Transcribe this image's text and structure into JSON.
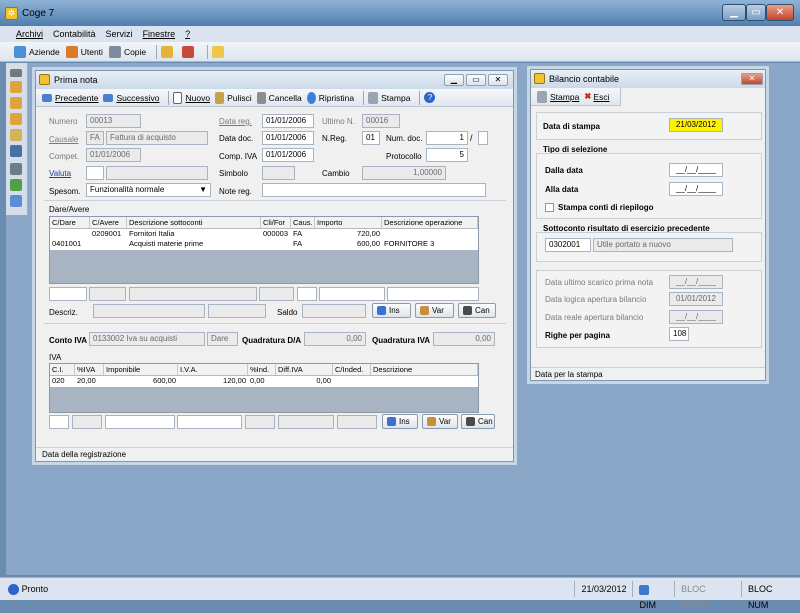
{
  "app": {
    "title": "Coge 7",
    "window_controls": {
      "minimize": "▁",
      "maximize": "▭",
      "close": "✕"
    }
  },
  "menu": [
    "Archivi",
    "Contabilità",
    "Servizi",
    "Finestre",
    "?"
  ],
  "toolbar": {
    "aziende": "Aziende",
    "utenti": "Utenti",
    "copie": "Copie"
  },
  "prima_nota": {
    "title": "Prima nota",
    "toolbar": {
      "precedente": "Precedente",
      "successivo": "Successivo",
      "nuovo": "Nuovo",
      "pulisci": "Pulisci",
      "cancella": "Cancella",
      "ripristina": "Ripristina",
      "stampa": "Stampa"
    },
    "labels": {
      "numero": "Numero",
      "causale": "Causale",
      "compet": "Compet.",
      "valuta": "Valuta",
      "spesom": "Spesom.",
      "data_reg": "Data reg.",
      "ultimo_n": "Ultimo N.",
      "data_doc": "Data doc.",
      "n_reg": "N.Reg.",
      "num_doc": "Num. doc.",
      "comp_iva": "Comp. IVA",
      "protocollo": "Protocollo",
      "simbolo": "Simbolo",
      "cambio": "Cambio",
      "note_reg": "Note reg."
    },
    "values": {
      "numero": "00013",
      "causale_code": "FA",
      "causale_desc": "Fattura di acquisto",
      "compet": "01/01/2006",
      "valuta": "",
      "spesom": "Funzionalità normale",
      "data_reg": "01/01/2006",
      "ultimo_n": "00016",
      "data_doc": "01/01/2006",
      "n_reg": "01",
      "num_doc": "1",
      "num_doc_sep": "/",
      "comp_iva": "01/01/2006",
      "protocollo": "5",
      "simbolo": "",
      "cambio": "1,00000",
      "note_reg": ""
    },
    "dare_avere": {
      "section": "Dare/Avere",
      "columns": [
        "C/Dare",
        "C/Avere",
        "Descrizione sottoconti",
        "Cli/For",
        "Caus.",
        "Importo",
        "Descrizione operazione"
      ],
      "rows": [
        [
          "",
          "0209001",
          "Fornitori Italia",
          "000003",
          "FA",
          "720,00",
          ""
        ],
        [
          "0401001",
          "",
          "Acquisti materie prime",
          "",
          "FA",
          "600,00",
          "FORNITORE 3"
        ]
      ],
      "descriz_label": "Descriz.",
      "saldo_label": "Saldo",
      "btn_ins": "Ins",
      "btn_var": "Var",
      "btn_can": "Can"
    },
    "conto_iva": {
      "label": "Conto IVA",
      "value": "0133002 Iva su acquisti",
      "dare": "Dare",
      "quadratura_da_label": "Quadratura D/A",
      "quadratura_da": "0,00",
      "quadratura_iva_label": "Quadratura IVA",
      "quadratura_iva": "0,00"
    },
    "iva": {
      "section": "IVA",
      "columns": [
        "C.I.",
        "%IVA",
        "Imponibile",
        "I.V.A.",
        "%Ind.",
        "Diff.IVA",
        "C/Inded.",
        "Descrizione"
      ],
      "rows": [
        [
          "020",
          "20,00",
          "600,00",
          "120,00",
          "0,00",
          "0,00",
          "",
          ""
        ]
      ],
      "btn_ins": "Ins",
      "btn_var": "Var",
      "btn_can": "Can"
    },
    "status": "Data della registrazione"
  },
  "bilancio": {
    "title": "Bilancio contabile",
    "toolbar": {
      "stampa": "Stampa",
      "esci": "Esci"
    },
    "data_stampa_label": "Data di stampa",
    "data_stampa": "21/03/2012",
    "tipo_selezione": "Tipo di selezione",
    "dalla_data_label": "Dalla data",
    "dalla_data": "__/__/____",
    "alla_data_label": "Alla data",
    "alla_data": "__/__/____",
    "stampa_riepilogo": "Stampa conti di riepilogo",
    "sottoconto_label": "Sottoconto risultato di esercizio precedente",
    "sottoconto_code": "0302001",
    "sottoconto_desc": "Utile portato a nuovo",
    "ultimo_scarico_label": "Data ultimo scarico prima nota",
    "ultimo_scarico": "__/__/____",
    "logica_label": "Data logica apertura bilancio",
    "logica": "01/01/2012",
    "reale_label": "Data reale apertura bilancio",
    "reale": "__/__/____",
    "righe_label": "Righe per pagina",
    "righe": "108",
    "status": "Data per la stampa"
  },
  "statusbar": {
    "left": "Pronto",
    "date": "21/03/2012",
    "dim": "DIM",
    "maius": "BLOC MAIUS",
    "num": "BLOC NUM"
  },
  "colors": {
    "highlight": "#fff200",
    "titlebar": "#4f7fae",
    "mdi": "#8aa7c7"
  }
}
